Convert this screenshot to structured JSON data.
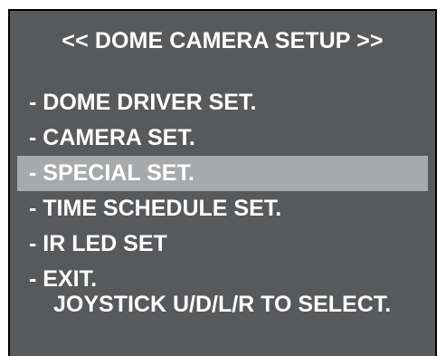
{
  "screen": {
    "title": "<< DOME CAMERA SETUP >>",
    "background_color": "#58595b",
    "highlight_color": "#a7a9ab",
    "text_color": "#ffffff"
  },
  "menu": {
    "selected_index": 2,
    "items": [
      {
        "label": "- DOME DRIVER SET."
      },
      {
        "label": "- CAMERA SET."
      },
      {
        "label": "- SPECIAL SET."
      },
      {
        "label": "- TIME SCHEDULE SET."
      },
      {
        "label": "- IR LED SET"
      },
      {
        "label": "- EXIT."
      }
    ]
  },
  "hint": "JOYSTICK U/D/L/R TO SELECT."
}
